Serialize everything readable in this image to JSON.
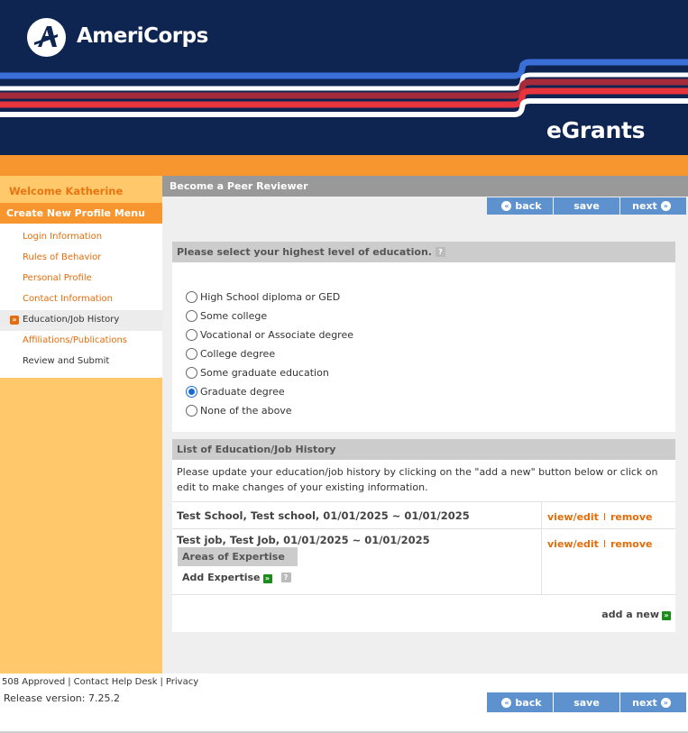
{
  "header": {
    "logo_text": "AmeriCorps",
    "product_name": "eGrants"
  },
  "sidebar": {
    "welcome": "Welcome Katherine",
    "menu_title": "Create New Profile Menu",
    "items": [
      {
        "label": "Login Information",
        "state": "link"
      },
      {
        "label": "Rules of Behavior",
        "state": "link"
      },
      {
        "label": "Personal Profile",
        "state": "link"
      },
      {
        "label": "Contact Information",
        "state": "link"
      },
      {
        "label": "Education/Job History",
        "state": "active"
      },
      {
        "label": "Affiliations/Publications",
        "state": "link"
      },
      {
        "label": "Review and Submit",
        "state": "plain"
      }
    ]
  },
  "main": {
    "title": "Become a Peer Reviewer",
    "buttons": {
      "back": "back",
      "save": "save",
      "next": "next"
    },
    "education": {
      "heading": "Please select your highest level of education.",
      "options": [
        "High School diploma or GED",
        "Some college",
        "Vocational or Associate degree",
        "College degree",
        "Some graduate education",
        "Graduate degree",
        "None of the above"
      ],
      "selected": "Graduate degree"
    },
    "history": {
      "heading": "List of Education/Job History",
      "instructions": "Please update your education/job history by clicking on the \"add a new\" button below or click on edit to make changes of your existing information.",
      "entries": [
        {
          "title": "Test School, Test school, 01/01/2025 ~ 01/01/2025",
          "view_edit": "view/edit",
          "remove": "remove"
        },
        {
          "title": "Test job, Test Job, 01/01/2025 ~ 01/01/2025",
          "view_edit": "view/edit",
          "remove": "remove",
          "areas_label": "Areas of Expertise",
          "add_expertise": "Add Expertise"
        }
      ],
      "add_new": "add a new"
    }
  },
  "footer": {
    "links": [
      "508 Approved",
      "Contact Help Desk",
      "Privacy"
    ],
    "release": "Release version: 7.25.2"
  },
  "colors": {
    "navy": "#0e2552",
    "orange": "#f7962f",
    "link_orange": "#e46c0a",
    "sidebar_yellow": "#ffc96b",
    "button_blue": "#5d92ce"
  }
}
